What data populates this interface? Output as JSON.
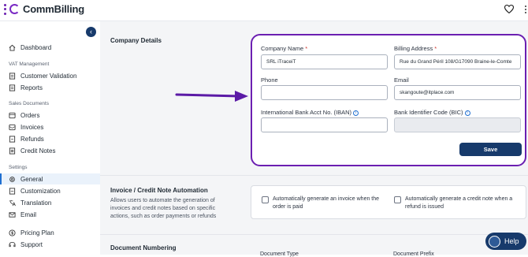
{
  "app": {
    "logo_text": "CommBilling"
  },
  "sidebar": {
    "dashboard": "Dashboard",
    "sections": {
      "vat": "VAT Management",
      "sales": "Sales Documents",
      "settings": "Settings"
    },
    "items": {
      "customer_validation": "Customer Validation",
      "reports": "Reports",
      "orders": "Orders",
      "invoices": "Invoices",
      "refunds": "Refunds",
      "credit_notes": "Credit Notes",
      "general": "General",
      "customization": "Customization",
      "translation": "Translation",
      "email": "Email",
      "pricing_plan": "Pricing Plan",
      "support": "Support"
    }
  },
  "company": {
    "section_title": "Company Details",
    "company_name_label": "Company Name",
    "company_name_value": "SRL iTraceiT",
    "billing_address_label": "Billing Address",
    "billing_address_value": "Rue du Grand Péril 108/G17090 Braine-le-Comte",
    "phone_label": "Phone",
    "phone_value": "",
    "email_label": "Email",
    "email_value": "skangoute@itplace.com",
    "iban_label": "International Bank Acct No. (IBAN)",
    "iban_value": "",
    "bic_label": "Bank Identifier Code (BIC)",
    "bic_value": "",
    "required_mark": "*",
    "save_label": "Save"
  },
  "automation": {
    "title": "Invoice / Credit Note Automation",
    "description": "Allows users to automate the generation of invoices and credit notes based on specific actions, such as order payments or refunds",
    "invoice_checkbox_label": "Automatically generate an invoice when the order is paid",
    "credit_note_checkbox_label": "Automatically generate a credit note when a refund is issued",
    "invoice_checked": false,
    "credit_note_checked": false
  },
  "numbering": {
    "title": "Document Numbering",
    "document_type_label": "Document Type",
    "document_prefix_label": "Document Prefix"
  },
  "help": {
    "label": "Help"
  },
  "colors": {
    "accent": "#6b1fb1",
    "primary": "#173a6b",
    "arrow": "#5b1aa6"
  }
}
